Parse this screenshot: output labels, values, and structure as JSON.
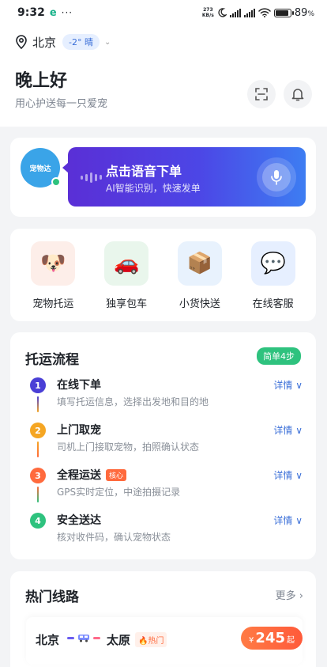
{
  "status_bar": {
    "time": "9:32",
    "app_badge": "e",
    "more": "···",
    "net_speed_top": "273",
    "net_speed_bottom": "KB/s",
    "battery": "89",
    "battery_unit": "%",
    "battery_level": 0.89
  },
  "header": {
    "city": "北京",
    "weather": "-2° 晴",
    "greeting": "晚上好",
    "subtitle": "用心护送每一只爱宠"
  },
  "voice": {
    "avatar_text": "宠物达",
    "title": "点击语音下单",
    "subtitle": "AI智能识别，快速发单"
  },
  "services": [
    {
      "label": "宠物托运",
      "icon": "🐶",
      "bg": "#fdeee9"
    },
    {
      "label": "独享包车",
      "icon": "🚗",
      "bg": "#e9f6ec"
    },
    {
      "label": "小货快送",
      "icon": "📦",
      "bg": "#e8f2fd"
    },
    {
      "label": "在线客服",
      "icon": "💬",
      "bg": "#e6efff"
    }
  ],
  "flow": {
    "title": "托运流程",
    "badge": "简单4步",
    "more_label": "详情 ∨",
    "steps": [
      {
        "num": "1",
        "title": "在线下单",
        "desc": "填写托运信息，选择出发地和目的地",
        "color": "#4a3fd6",
        "tag": ""
      },
      {
        "num": "2",
        "title": "上门取宠",
        "desc": "司机上门接取宠物，拍照确认状态",
        "color": "#f5a623",
        "tag": ""
      },
      {
        "num": "3",
        "title": "全程运送",
        "desc": "GPS实时定位，中途拍摄记录",
        "color": "#ff6a3d",
        "tag": "核心"
      },
      {
        "num": "4",
        "title": "安全送达",
        "desc": "核对收件码，确认宠物状态",
        "color": "#2ec27e",
        "tag": ""
      }
    ]
  },
  "routes": {
    "title": "热门线路",
    "more": "更多 ›",
    "items": [
      {
        "from": "北京",
        "to": "太原",
        "tag": "🔥热门",
        "currency": "¥",
        "price": "245",
        "unit": "起"
      }
    ]
  }
}
